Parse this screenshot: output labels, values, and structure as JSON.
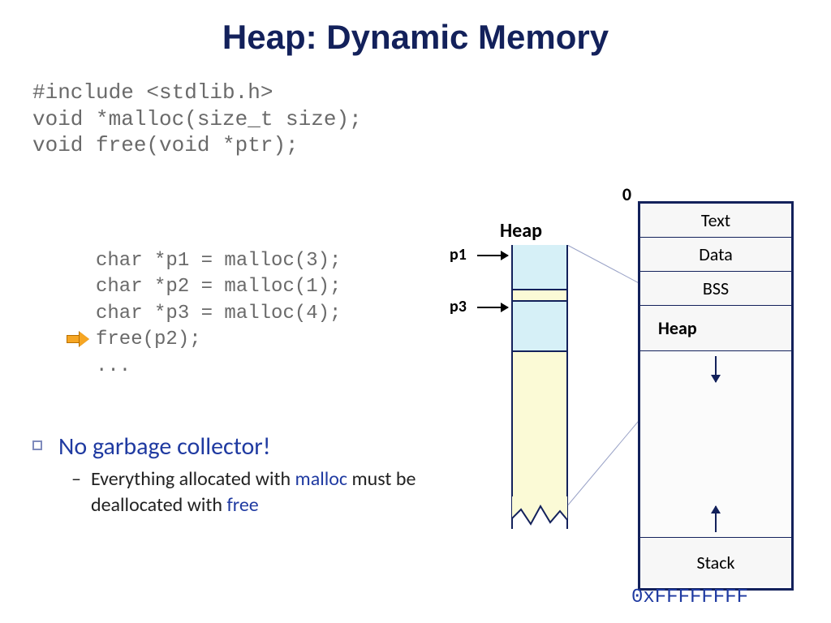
{
  "title": "Heap: Dynamic Memory",
  "code_top": "#include <stdlib.h>\nvoid *malloc(size_t size);\nvoid free(void *ptr);",
  "code_mid": "char *p1 = malloc(3);\nchar *p2 = malloc(1);\nchar *p3 = malloc(4);\nfree(p2);\n...",
  "bullet1": "No garbage collector!",
  "bullet2_pre": "Everything allocated with ",
  "bullet2_kw1": "malloc",
  "bullet2_mid": " must be deallocated with ",
  "bullet2_kw2": "free",
  "heap_label": "Heap",
  "p1_label": "p1",
  "p3_label": "p3",
  "zero_label": "0",
  "max_addr": "0xFFFFFFFF",
  "segments": {
    "text": "Text",
    "data": "Data",
    "bss": "BSS",
    "heap": "Heap",
    "stack": "Stack"
  }
}
